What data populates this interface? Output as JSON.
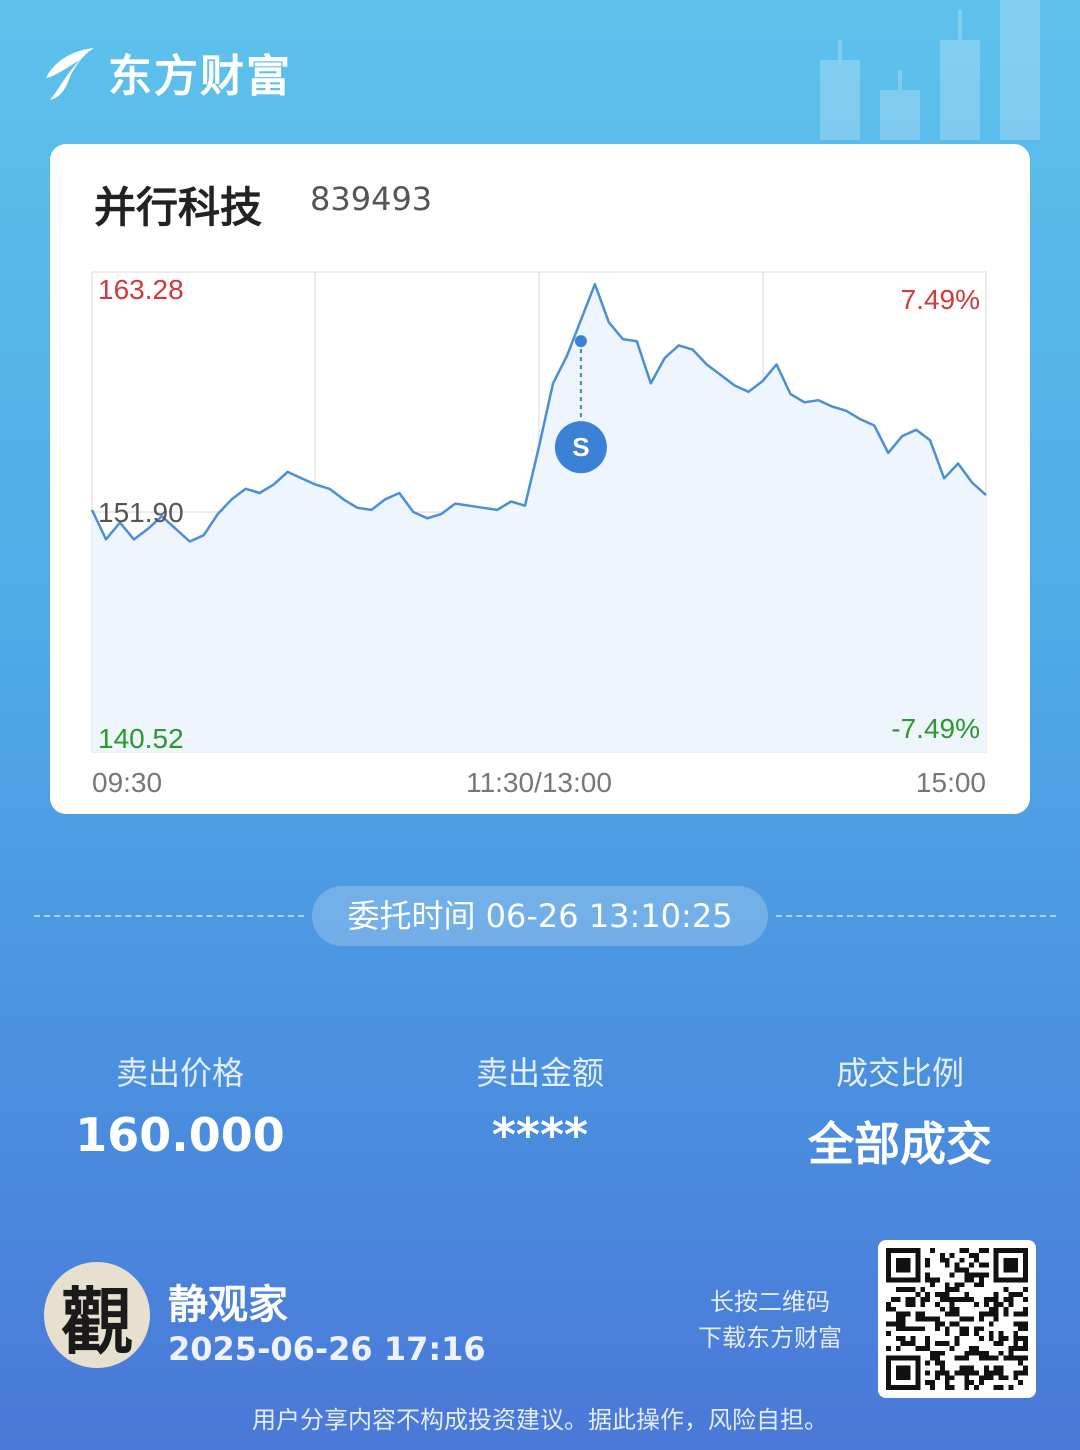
{
  "brand": {
    "name": "东方财富",
    "primary_color": "#4a9ee6",
    "logo_icon": "leaf-logo-icon"
  },
  "stock": {
    "name": "并行科技",
    "code": "839493"
  },
  "chart_data": {
    "type": "line",
    "title": "",
    "x_tick_labels": [
      "09:30",
      "11:30/13:00",
      "15:00"
    ],
    "y_tick_labels_left": [
      "163.28",
      "151.90",
      "140.52"
    ],
    "y_tick_labels_right": [
      "7.49%",
      "",
      "-7.49%"
    ],
    "ylim": [
      140.52,
      163.28
    ],
    "reference_price": 151.9,
    "grid": true,
    "marker": {
      "label": "S",
      "time_index": 35,
      "price": 160.0
    },
    "colors": {
      "line": "#4a8fd8",
      "fill": "#eef5fd",
      "up": "#d03a3a",
      "down": "#2a9a2a",
      "neutral": "#555555"
    },
    "series": [
      {
        "values": [
          152.0,
          150.6,
          151.4,
          150.6,
          151.1,
          151.7,
          151.1,
          150.5,
          150.8,
          151.8,
          152.5,
          153.0,
          152.8,
          153.2,
          153.8,
          153.5,
          153.2,
          153.0,
          152.5,
          152.1,
          152.0,
          152.5,
          152.8,
          151.9,
          151.6,
          151.8,
          152.3,
          152.2,
          152.1,
          152.0,
          152.4,
          152.2,
          155.0,
          158.0,
          159.3,
          161.0,
          162.7,
          160.9,
          160.1,
          160.0,
          158.0,
          159.2,
          159.8,
          159.6,
          158.9,
          158.4,
          157.9,
          157.6,
          158.1,
          158.9,
          157.5,
          157.1,
          157.2,
          156.9,
          156.7,
          156.3,
          156.0,
          154.7,
          155.5,
          155.8,
          155.3,
          153.5,
          154.2,
          153.3,
          152.7
        ]
      }
    ]
  },
  "order": {
    "time_label": "委托时间",
    "time_value": "06-26 13:10:25"
  },
  "stats": [
    {
      "label": "卖出价格",
      "value": "160.000"
    },
    {
      "label": "卖出金额",
      "value": "****"
    },
    {
      "label": "成交比例",
      "value": "全部成交"
    }
  ],
  "user": {
    "avatar_glyph": "觀",
    "name": "静观家",
    "time": "2025-06-26 17:16"
  },
  "qr": {
    "hint_line1": "长按二维码",
    "hint_line2": "下载东方财富",
    "icon": "qr-code-icon"
  },
  "disclaimer": "用户分享内容不构成投资建议。据此操作，风险自担。"
}
